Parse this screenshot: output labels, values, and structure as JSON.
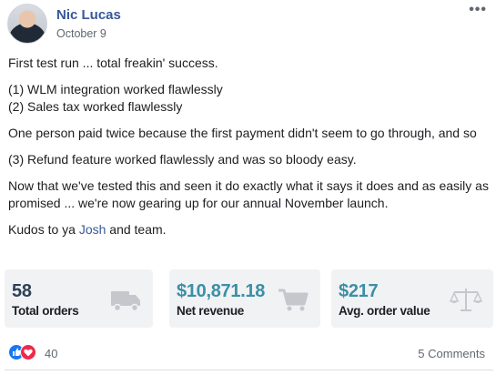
{
  "post": {
    "author": "Nic Lucas",
    "date": "October 9",
    "more_label": "•••",
    "body": {
      "line1": "First test run ... total freakin' success.",
      "line2": "(1) WLM integration worked flawlessly",
      "line3": "(2) Sales tax worked flawlessly",
      "line4": "One person paid twice because the first payment didn't seem to go through, and so",
      "line5": "(3) Refund feature worked flawlessly and was so bloody easy.",
      "line6": "Now that we've tested this and seen it do exactly what it says it does and as easily as promised ... we're now gearing up for our annual November launch.",
      "line7_prefix": "Kudos to ya ",
      "line7_link": "Josh",
      "line7_suffix": " and team."
    }
  },
  "stats": [
    {
      "value": "58",
      "label": "Total orders",
      "icon": "truck-icon",
      "color": "#2e4057"
    },
    {
      "value": "$10,871.18",
      "label": "Net revenue",
      "icon": "cart-icon",
      "color": "#3b8fa5"
    },
    {
      "value": "$217",
      "label": "Avg. order value",
      "icon": "scale-icon",
      "color": "#3b8fa5"
    }
  ],
  "footer": {
    "reaction_count": "40",
    "comments_label": "5 Comments"
  },
  "colors": {
    "link": "#385898",
    "like": "#1877f2",
    "love": "#f0284a",
    "card_bg": "#f1f2f4",
    "icon_gray": "#c4c8cd"
  }
}
